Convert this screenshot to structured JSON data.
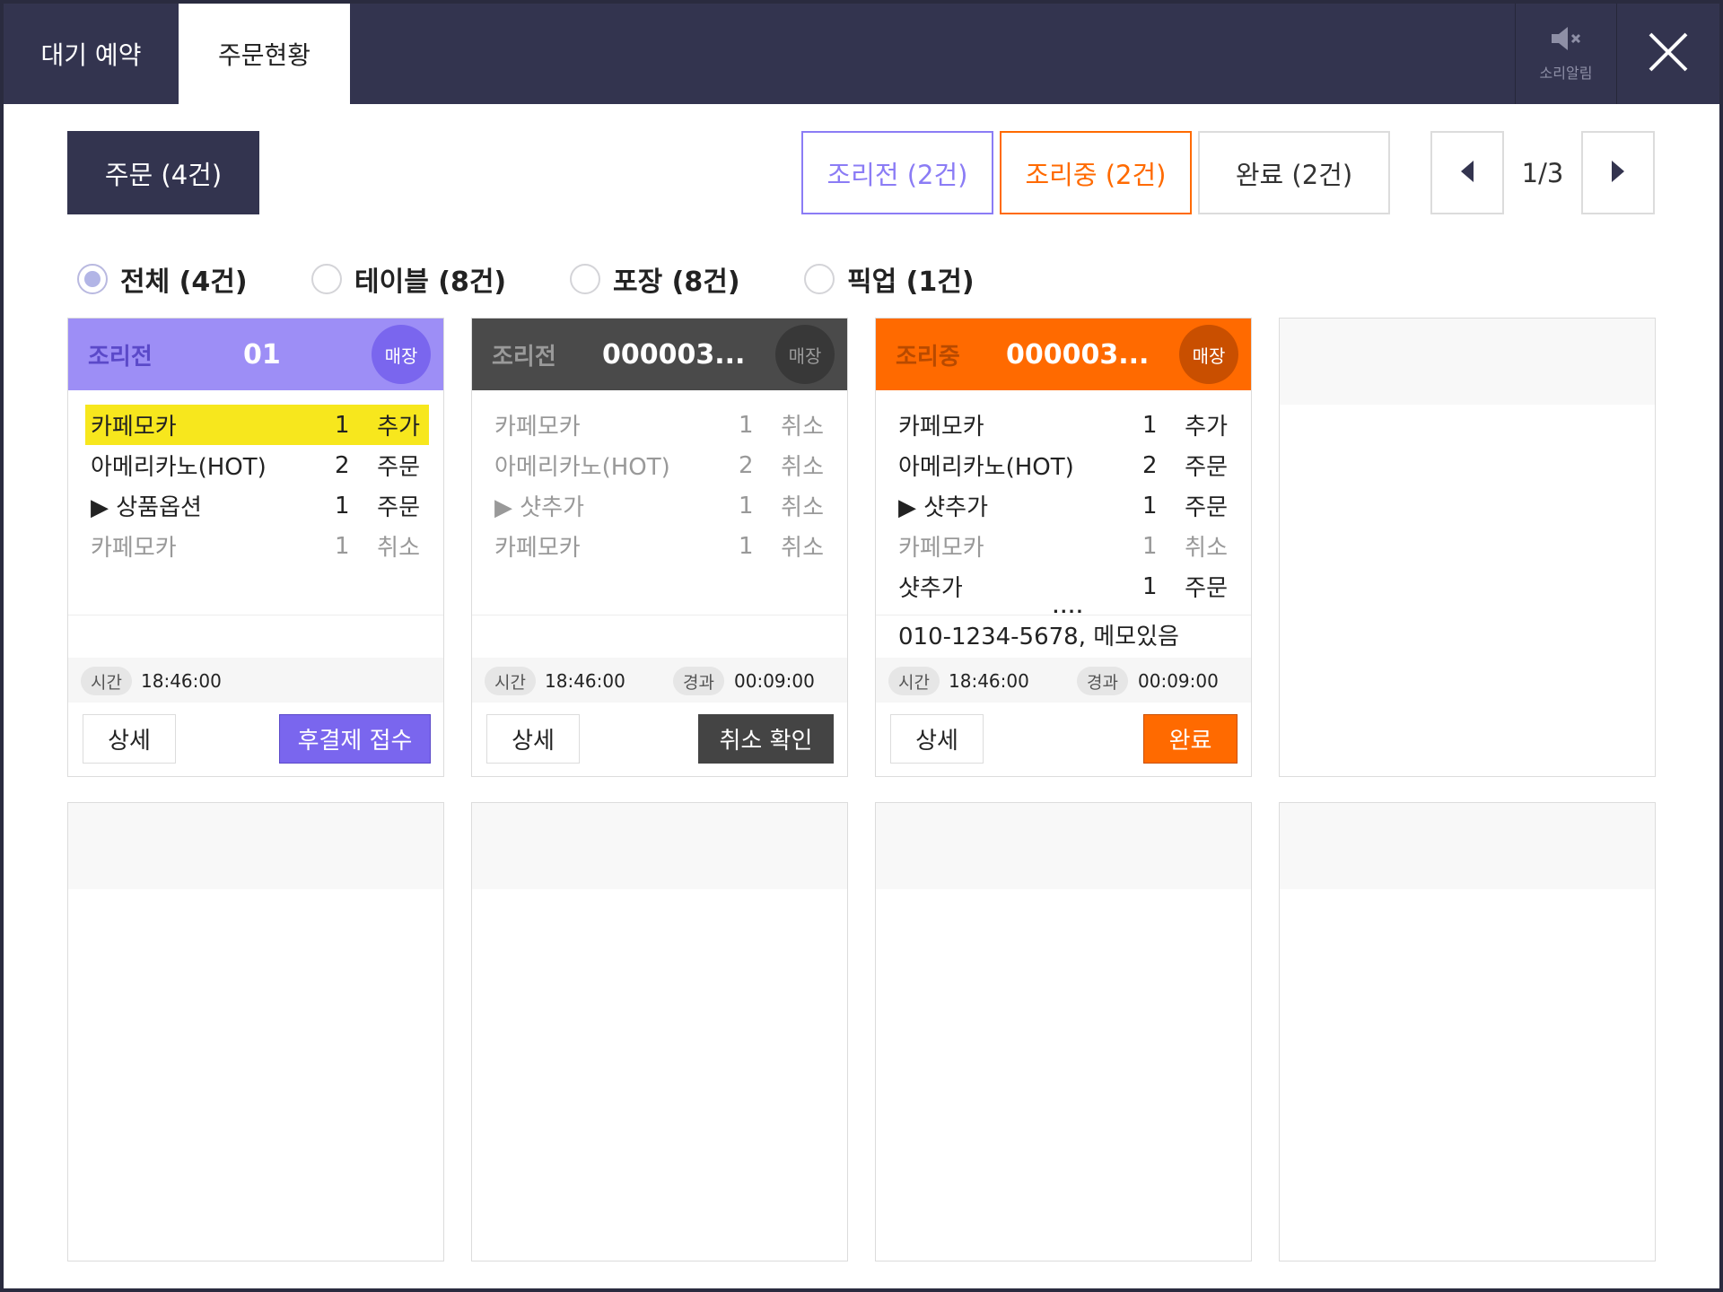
{
  "header": {
    "tabs": [
      "대기 예약",
      "주문현황"
    ],
    "sound_label": "소리알림"
  },
  "toolbar": {
    "order_count": "주문 (4건)",
    "status_filters": [
      "조리전 (2건)",
      "조리중 (2건)",
      "완료 (2건)"
    ],
    "page_indicator": "1/3"
  },
  "filters": [
    "전체 (4건)",
    "테이블 (8건)",
    "포장 (8건)",
    "픽업 (1건)"
  ],
  "colors": {
    "header_bg": "#33344f",
    "purple": "#8b7cf5",
    "orange": "#ff6a00",
    "dark": "#444444",
    "highlight": "#f7e71d"
  },
  "cards": [
    {
      "status": "조리전",
      "order_no": "01",
      "badge": "매장",
      "items": [
        {
          "name": "카페모카",
          "qty": "1",
          "action": "추가"
        },
        {
          "name": "아메리카노(HOT)",
          "qty": "2",
          "action": "주문"
        },
        {
          "name": "▶ 상품옵션",
          "qty": "1",
          "action": "주문"
        },
        {
          "name": "카페모카",
          "qty": "1",
          "action": "취소"
        }
      ],
      "time_label": "시간",
      "time": "18:46:00",
      "detail_label": "상세",
      "action_label": "후결제 접수"
    },
    {
      "status": "조리전",
      "order_no": "000003...",
      "badge": "매장",
      "items": [
        {
          "name": "카페모카",
          "qty": "1",
          "action": "취소"
        },
        {
          "name": "아메리카노(HOT)",
          "qty": "2",
          "action": "취소"
        },
        {
          "name": "▶ 샷추가",
          "qty": "1",
          "action": "취소"
        },
        {
          "name": "카페모카",
          "qty": "1",
          "action": "취소"
        }
      ],
      "time_label": "시간",
      "time": "18:46:00",
      "elapsed_label": "경과",
      "elapsed": "00:09:00",
      "detail_label": "상세",
      "action_label": "취소 확인"
    },
    {
      "status": "조리중",
      "order_no": "000003...",
      "badge": "매장",
      "items": [
        {
          "name": "카페모카",
          "qty": "1",
          "action": "추가"
        },
        {
          "name": "아메리카노(HOT)",
          "qty": "2",
          "action": "주문"
        },
        {
          "name": "▶ 샷추가",
          "qty": "1",
          "action": "주문"
        },
        {
          "name": "카페모카",
          "qty": "1",
          "action": "취소"
        },
        {
          "name": "샷추가",
          "qty": "1",
          "action": "주문"
        }
      ],
      "more": "....",
      "memo": "010-1234-5678, 메모있음",
      "time_label": "시간",
      "time": "18:46:00",
      "elapsed_label": "경과",
      "elapsed": "00:09:00",
      "detail_label": "상세",
      "action_label": "완료"
    }
  ]
}
